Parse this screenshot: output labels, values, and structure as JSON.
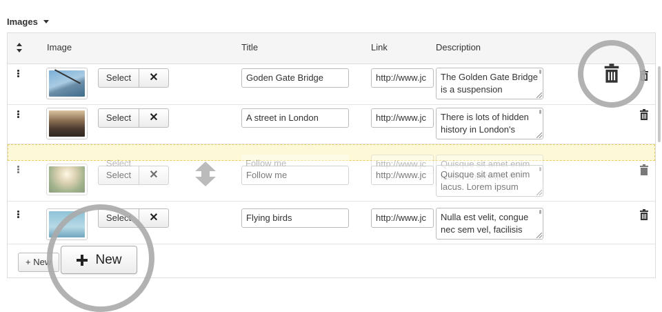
{
  "section": {
    "title": "Images"
  },
  "columns": {
    "image": "Image",
    "title": "Title",
    "link": "Link",
    "description": "Description"
  },
  "buttons": {
    "select": "Select",
    "remove": "✕",
    "add_small": "+ New",
    "add_zoom": "New"
  },
  "rows": [
    {
      "title": "Goden Gate Bridge",
      "link": "http://www.jc",
      "description": "The Golden Gate Bridge is a suspension"
    },
    {
      "title": "A street in London",
      "link": "http://www.jc",
      "description": "There is lots of hidden history in London's"
    },
    {
      "title": "Follow me",
      "link": "http://www.jc",
      "description": "Quisque sit amet enim lacus. Lorem ipsum"
    },
    {
      "title": "Flying birds",
      "link": "http://www.jc",
      "description": "Nulla est velit, congue nec sem vel, facilisis"
    }
  ],
  "icons": {
    "sort": "sort-icon",
    "drag": "drag-handle-icon",
    "trash": "trash-icon",
    "move": "move-vertical-icon",
    "plus": "plus-icon"
  },
  "colors": {
    "placeholder_bg": "#fcf8d8",
    "placeholder_border": "#e7cd5a",
    "highlight_circle": "#aaaaaa",
    "header_bg": "#f5f5f5"
  }
}
